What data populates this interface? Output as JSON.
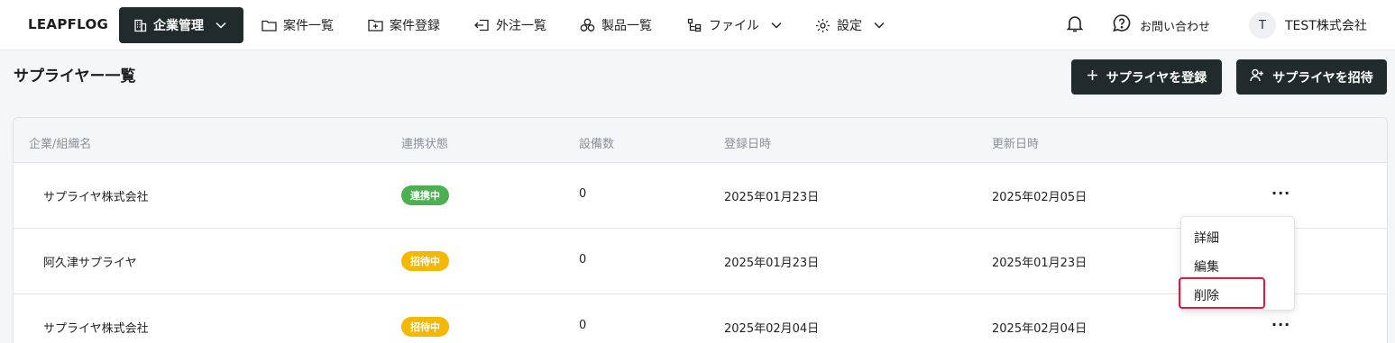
{
  "header": {
    "logo": "LEAPFLOG",
    "nav": [
      {
        "label": "企業管理",
        "icon": "building-icon",
        "active": true
      },
      {
        "label": "案件一覧",
        "icon": "folder-icon"
      },
      {
        "label": "案件登録",
        "icon": "folder-plus-icon"
      },
      {
        "label": "外注一覧",
        "icon": "outsource-icon"
      },
      {
        "label": "製品一覧",
        "icon": "cubes-icon"
      },
      {
        "label": "ファイル",
        "icon": "file-tree-icon"
      },
      {
        "label": "設定",
        "icon": "gear-icon"
      }
    ],
    "contact": "お問い合わせ",
    "avatar_initial": "T",
    "company": "TEST株式会社"
  },
  "page": {
    "title": "サプライヤー一覧",
    "register_button": "サプライヤを登録",
    "invite_button": "サプライヤを招待"
  },
  "table": {
    "columns": [
      "企業/組織名",
      "連携状態",
      "設備数",
      "登録日時",
      "更新日時"
    ],
    "rows": [
      {
        "name": "サプライヤ株式会社",
        "status": "連携中",
        "status_color": "#4caf50",
        "equipment": "0",
        "created": "2025年01月23日",
        "updated": "2025年02月05日",
        "actions": "···"
      },
      {
        "name": "阿久津サプライヤ",
        "status": "招待中",
        "status_color": "#f5b800",
        "equipment": "0",
        "created": "2025年01月23日",
        "updated": "2025年01月23日",
        "actions": "···"
      },
      {
        "name": "サプライヤ株式会社",
        "status": "招待中",
        "status_color": "#f5b800",
        "equipment": "0",
        "created": "2025年02月04日",
        "updated": "2025年02月04日",
        "actions": "···"
      }
    ]
  },
  "menu": {
    "items": [
      "詳細",
      "編集",
      "削除"
    ],
    "highlight_color": "#e8163c"
  },
  "colors": {
    "accent_dark": "#222b2b",
    "connected": "#4caf50",
    "invited": "#f5b800"
  }
}
